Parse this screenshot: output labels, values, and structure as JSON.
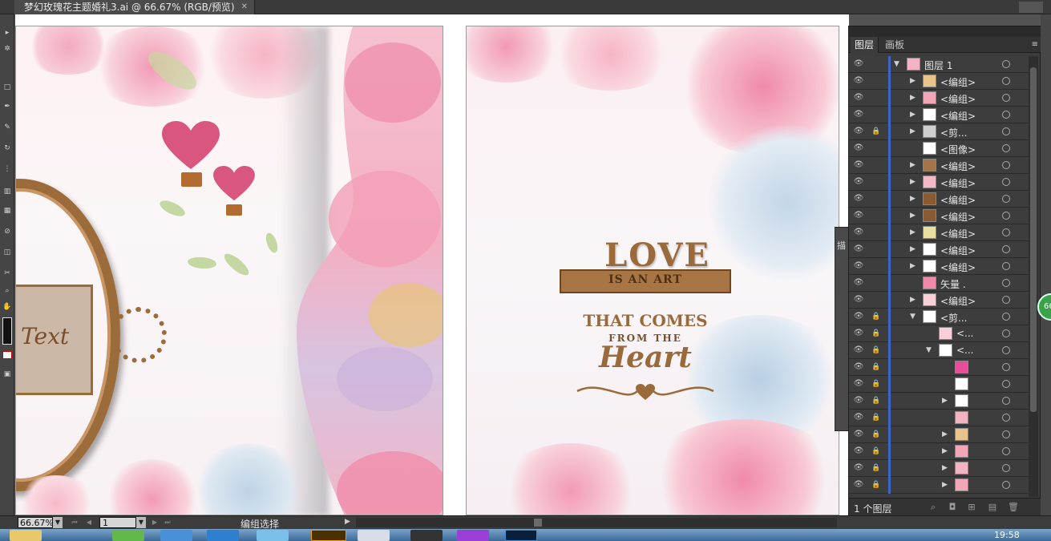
{
  "document": {
    "tab_title": "梦幻玫瑰花主题婚礼3.ai @ 66.67% (RGB/预览)",
    "close_glyph": "✕"
  },
  "artwork": {
    "frame_text": "Text",
    "love_title": "LOVE",
    "love_ribbon": "IS AN ART",
    "love_line1": "THAT COMES",
    "love_line2": "FROM THE",
    "love_heart_word": "Heart"
  },
  "colors": {
    "accent_brown": "#9b6a3a",
    "heart_pink": "#d9577f",
    "layer_bar_blue": "#3b64c8"
  },
  "layers_panel": {
    "tab_layers": "图层",
    "tab_artboards": "画板",
    "menu_glyph": "≡",
    "rows": [
      {
        "name": "图层 1",
        "indent": 0,
        "expanded": true,
        "locked": false,
        "has_toggle": true
      },
      {
        "name": "<编组>",
        "indent": 1,
        "expanded": false,
        "locked": false,
        "has_toggle": true
      },
      {
        "name": "<编组>",
        "indent": 1,
        "expanded": false,
        "locked": false,
        "has_toggle": true
      },
      {
        "name": "<编组>",
        "indent": 1,
        "expanded": false,
        "locked": false,
        "has_toggle": true
      },
      {
        "name": "<剪...",
        "indent": 1,
        "expanded": false,
        "locked": true,
        "has_toggle": true
      },
      {
        "name": "<图像>",
        "indent": 1,
        "expanded": false,
        "locked": false,
        "has_toggle": false
      },
      {
        "name": "<编组>",
        "indent": 1,
        "expanded": false,
        "locked": false,
        "has_toggle": true
      },
      {
        "name": "<编组>",
        "indent": 1,
        "expanded": false,
        "locked": false,
        "has_toggle": true
      },
      {
        "name": "<编组>",
        "indent": 1,
        "expanded": false,
        "locked": false,
        "has_toggle": true
      },
      {
        "name": "<编组>",
        "indent": 1,
        "expanded": false,
        "locked": false,
        "has_toggle": true
      },
      {
        "name": "<编组>",
        "indent": 1,
        "expanded": false,
        "locked": false,
        "has_toggle": true
      },
      {
        "name": "<编组>",
        "indent": 1,
        "expanded": false,
        "locked": false,
        "has_toggle": true
      },
      {
        "name": "<编组>",
        "indent": 1,
        "expanded": false,
        "locked": false,
        "has_toggle": true
      },
      {
        "name": "矢量 .",
        "indent": 1,
        "expanded": false,
        "locked": false,
        "has_toggle": false
      },
      {
        "name": "<编组>",
        "indent": 1,
        "expanded": false,
        "locked": false,
        "has_toggle": true
      },
      {
        "name": "<剪...",
        "indent": 1,
        "expanded": true,
        "locked": true,
        "has_toggle": true
      },
      {
        "name": "<...",
        "indent": 2,
        "expanded": false,
        "locked": true,
        "has_toggle": false
      },
      {
        "name": "<...",
        "indent": 2,
        "expanded": true,
        "locked": true,
        "has_toggle": true
      },
      {
        "name": "",
        "indent": 3,
        "expanded": false,
        "locked": true,
        "has_toggle": false
      },
      {
        "name": "",
        "indent": 3,
        "expanded": false,
        "locked": true,
        "has_toggle": false
      },
      {
        "name": "",
        "indent": 3,
        "expanded": false,
        "locked": true,
        "has_toggle": true
      },
      {
        "name": "",
        "indent": 3,
        "expanded": false,
        "locked": true,
        "has_toggle": false
      },
      {
        "name": "",
        "indent": 3,
        "expanded": false,
        "locked": true,
        "has_toggle": true
      },
      {
        "name": "",
        "indent": 3,
        "expanded": false,
        "locked": true,
        "has_toggle": true
      },
      {
        "name": "",
        "indent": 3,
        "expanded": false,
        "locked": true,
        "has_toggle": true
      },
      {
        "name": "",
        "indent": 3,
        "expanded": false,
        "locked": true,
        "has_toggle": true
      }
    ],
    "footer_count": "1 个图层"
  },
  "side_stub_label": "描",
  "zoom_badge": "66",
  "status": {
    "zoom_value": "66.67%",
    "page_value": "1",
    "status_text": "编组选择"
  },
  "taskbar": {
    "clock": "19:58"
  }
}
